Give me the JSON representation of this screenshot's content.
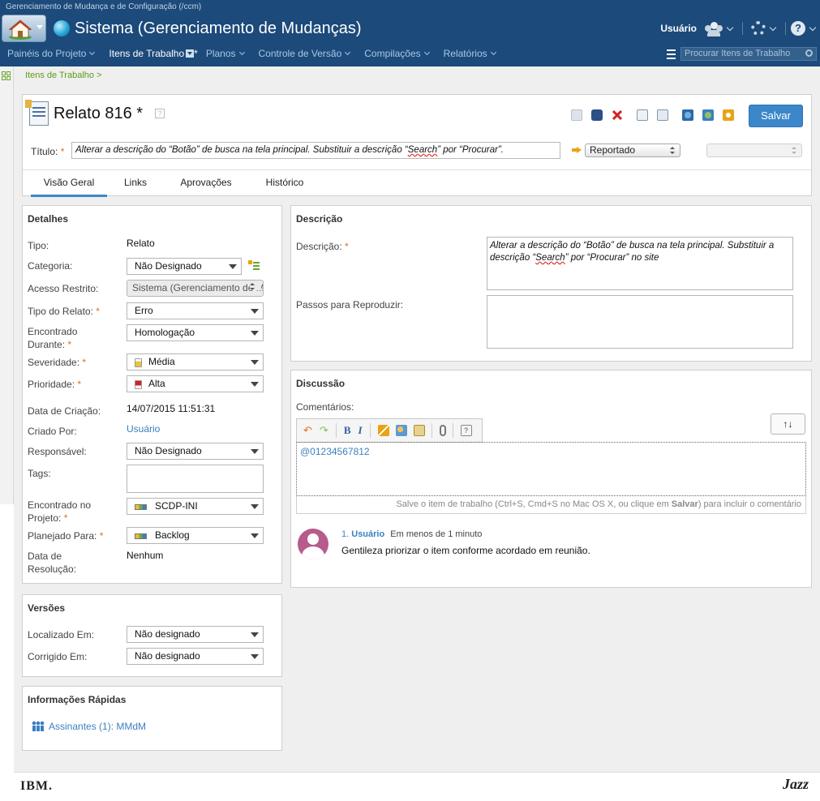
{
  "window": {
    "title": "Gerenciamento de Mudança e de Configuração (/ccm)"
  },
  "header": {
    "app_title": "Sistema (Gerenciamento de Mudanças)",
    "user_label": "Usuário"
  },
  "nav": {
    "items": [
      "Painéis do Projeto",
      "Itens de Trabalho",
      "Planos",
      "Controle de Versão",
      "Compilações",
      "Relatórios"
    ],
    "active_suffix": "*",
    "search_placeholder": "Procurar Itens de Trabalho"
  },
  "breadcrumb": "Itens de Trabalho >",
  "work_item": {
    "title": "Relato 816 *",
    "save_label": "Salvar",
    "title_label": "Título:",
    "title_value_pre": "Alterar a descrição do “Botão” de busca na tela principal. Substituir a descrição “",
    "title_value_err": "Search",
    "title_value_post": "” por “Procurar”.",
    "state": "Reportado",
    "required_mark": "*"
  },
  "tabs": [
    "Visão Geral",
    "Links",
    "Aprovações",
    "Histórico"
  ],
  "details": {
    "title": "Detalhes",
    "tipo_label": "Tipo:",
    "tipo_value": "Relato",
    "categoria_label": "Categoria:",
    "categoria_value": "Não Designado",
    "acesso_label": "Acesso Restrito:",
    "acesso_value": "Sistema (Gerenciamento de Mudanças)",
    "tipo_relato_label": "Tipo do Relato:",
    "tipo_relato_value": "Erro",
    "encontrado_label_1": "Encontrado",
    "encontrado_label_2": "Durante:",
    "encontrado_value": "Homologação",
    "severidade_label": "Severidade:",
    "severidade_value": "Média",
    "prioridade_label": "Prioridade:",
    "prioridade_value": "Alta",
    "criacao_label": "Data de Criação:",
    "criacao_value": "14/07/2015 11:51:31",
    "criado_label": "Criado Por:",
    "criado_value": "Usuário",
    "responsavel_label": "Responsável:",
    "responsavel_value": "Não Designado",
    "tags_label": "Tags:",
    "projeto_label_1": "Encontrado no",
    "projeto_label_2": "Projeto:",
    "projeto_value": "SCDP-INI",
    "planejado_label": "Planejado Para:",
    "planejado_value": "Backlog",
    "resolucao_label_1": "Data de",
    "resolucao_label_2": "Resolução:",
    "resolucao_value": "Nenhum"
  },
  "versions": {
    "title": "Versões",
    "localizado_label": "Localizado Em:",
    "localizado_value": "Não designado",
    "corrigido_label": "Corrigido Em:",
    "corrigido_value": "Não designado"
  },
  "quick_info": {
    "title": "Informações Rápidas",
    "subscribers": "Assinantes (1):",
    "subscriber_name": "MMdM"
  },
  "description": {
    "title": "Descrição",
    "desc_label": "Descrição:",
    "desc_pre": "Alterar a descrição do “Botão” de busca na tela principal. Substituir a descrição “",
    "desc_err": "Search",
    "desc_post": "” por “Procurar” no site",
    "steps_label": "Passos para Reproduzir:"
  },
  "discussion": {
    "title": "Discussão",
    "comments_label": "Comentários:",
    "comment_value": "@01234567812",
    "hint_pre": "Salve o item de trabalho (Ctrl+S, Cmd+S no Mac OS X, ou clique em ",
    "hint_bold": "Salvar",
    "hint_post": ") para incluir o comentário",
    "sort_label": "↑↓",
    "comments": [
      {
        "index": "1.",
        "author": "Usuário",
        "time": "Em menos de 1 minuto",
        "text": "Gentileza priorizar o item conforme acordado em reunião."
      }
    ]
  },
  "footer": {
    "ibm": "IBM.",
    "jazz": "Jazz"
  },
  "colors": {
    "header_bg": "#1c4a7a",
    "accent": "#3c87c9",
    "required": "#e0701b",
    "link": "#3c7fc0"
  }
}
